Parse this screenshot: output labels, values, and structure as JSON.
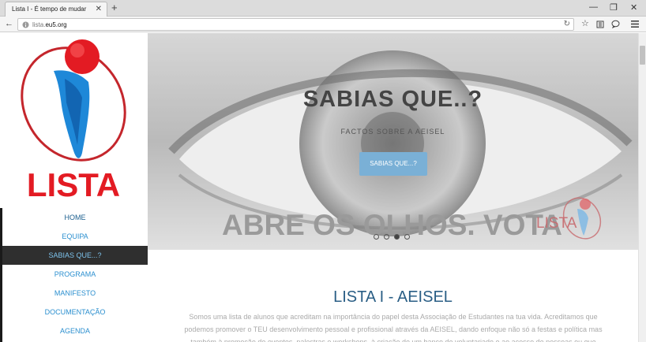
{
  "browser": {
    "tab_title": "Lista I - É tempo de mudar",
    "tab_close": "✕",
    "new_tab": "+",
    "url_prefix": "lista.",
    "url_domain": "eu5.org",
    "win_minimize": "—",
    "win_restore": "❐",
    "win_close": "✕"
  },
  "logo": {
    "text": "LISTA",
    "colors": {
      "red": "#e31b23",
      "blue": "#1e88d8"
    }
  },
  "menu": {
    "items": [
      {
        "label": "HOME"
      },
      {
        "label": "EQUIPA"
      },
      {
        "label": "SABIAS QUE...?"
      },
      {
        "label": "PROGRAMA"
      },
      {
        "label": "MANIFESTO"
      },
      {
        "label": "DOCUMENTAÇÃO"
      },
      {
        "label": "AGENDA"
      }
    ],
    "active_index": 2
  },
  "hero": {
    "title": "SABIAS QUE..?",
    "subtitle": "FACTOS SOBRE A AEISEL",
    "button": "SABIAS QUE...?",
    "slogan": "ABRE OS OLHOS. VOTA",
    "watermark": "LISTA",
    "slides": 4,
    "active_slide": 3
  },
  "intro": {
    "title": "LISTA I - AEISEL",
    "text": "Somos uma lista de alunos que acreditam na importância do papel desta Associação de Estudantes na tua vida. Acreditamos que podemos promover o TEU desenvolvimento pessoal e profissional através da AEISEL, dando enfoque não só a festas e política mas também à promoção de eventos, palestras e workshops, à criação de um banco de voluntariado e ao acesso de pessoas ou que"
  }
}
